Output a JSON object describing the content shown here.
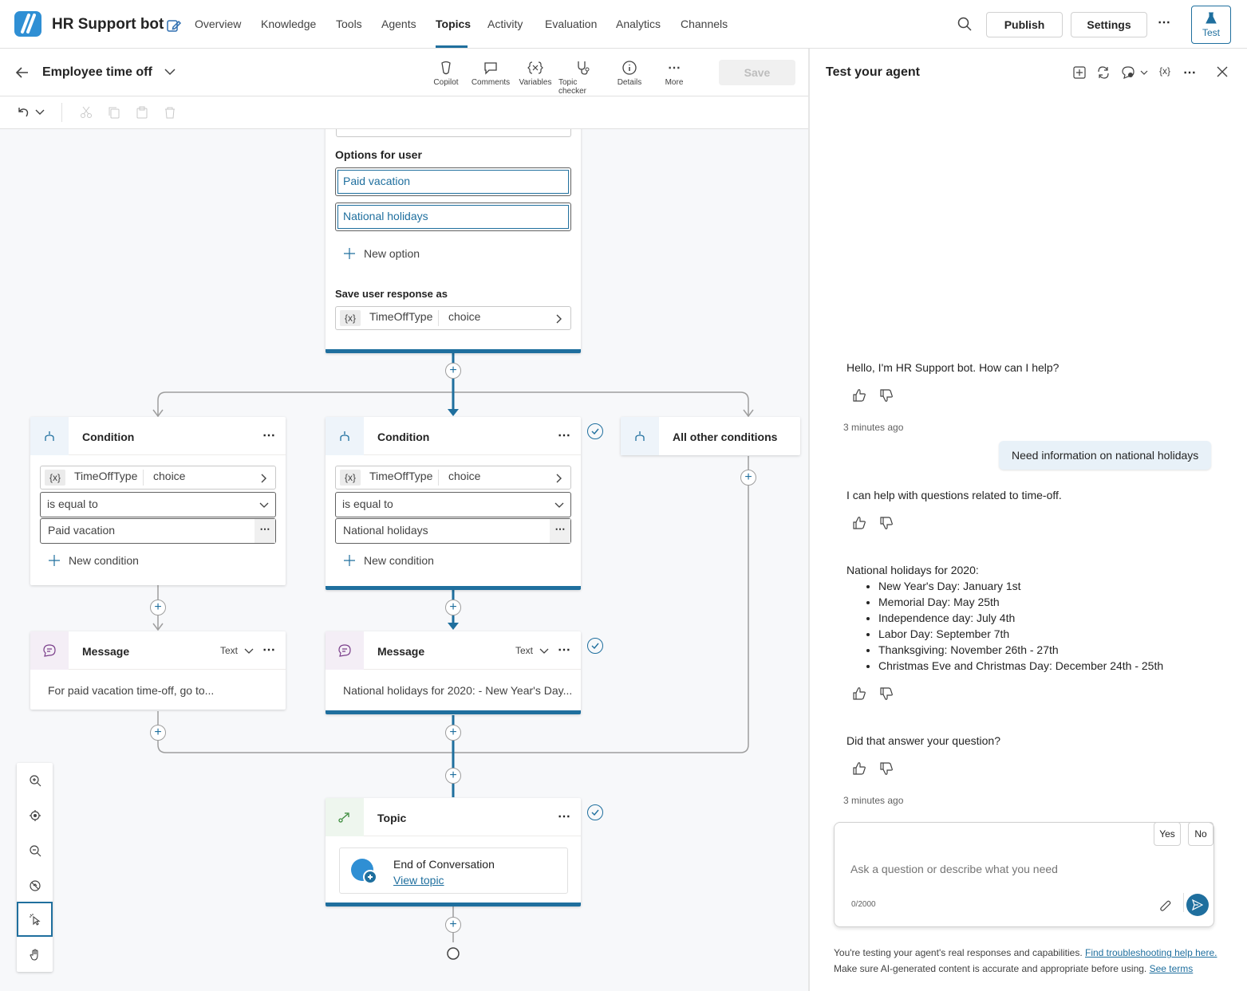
{
  "app": {
    "title": "HR Support bot"
  },
  "nav": [
    "Overview",
    "Knowledge",
    "Tools",
    "Agents",
    "Topics",
    "Activity",
    "Evaluation",
    "Analytics",
    "Channels"
  ],
  "nav_active": "Topics",
  "topbar": {
    "publish": "Publish",
    "settings": "Settings",
    "test": "Test",
    "more": "⋯"
  },
  "topic": {
    "name": "Employee time off"
  },
  "toolbar": {
    "copilot": "Copilot",
    "comments": "Comments",
    "variables": "Variables",
    "topic_checker": "Topic checker",
    "details": "Details",
    "more": "More",
    "save": "Save",
    "more_glyph": "⋯"
  },
  "question_node": {
    "options_label": "Options for user",
    "options": [
      "Paid vacation",
      "National holidays"
    ],
    "new_option": "New option",
    "save_label": "Save user response as",
    "var_name": "TimeOffType",
    "var_type": "choice",
    "var_icon": "{x}"
  },
  "conditions": [
    {
      "title": "Condition",
      "var": "TimeOffType",
      "type": "choice",
      "operator": "is equal to",
      "value": "Paid vacation",
      "new_condition": "New condition"
    },
    {
      "title": "Condition",
      "var": "TimeOffType",
      "type": "choice",
      "operator": "is equal to",
      "value": "National holidays",
      "new_condition": "New condition"
    },
    {
      "title": "All other conditions"
    }
  ],
  "messages": [
    {
      "title": "Message",
      "mode": "Text",
      "text": "For paid vacation time-off, go to..."
    },
    {
      "title": "Message",
      "mode": "Text",
      "text": "National holidays for 2020: - New Year's Day..."
    }
  ],
  "topic_node": {
    "title": "Topic",
    "target": "End of Conversation",
    "link": "View topic"
  },
  "dots": "⋯",
  "test_panel": {
    "title": "Test your agent",
    "greeting": "Hello, I'm HR Support bot. How can I help?",
    "timestamp1": "3 minutes ago",
    "user_msg": "Need information on national holidays",
    "reply1": "I can help with questions related to time-off.",
    "holidays_title": "National holidays for 2020:",
    "holidays": [
      "New Year's Day: January 1st",
      "Memorial Day: May 25th",
      "Independence day: July 4th",
      "Labor Day: September 7th",
      "Thanksgiving: November 26th - 27th",
      "Christmas Eve and Christmas Day: December 24th - 25th"
    ],
    "question": "Did that answer your question?",
    "timestamp2": "3 minutes ago",
    "yes": "Yes",
    "no": "No",
    "input_placeholder": "Ask a question or describe what you need",
    "char_count": "0/2000",
    "footer_text1": "You're testing your agent's real responses and capabilities. ",
    "footer_link1": "Find troubleshooting help here.",
    "footer_text2": " Make sure AI-generated content is accurate and appropriate before using. ",
    "footer_link2": "See terms",
    "var_icon": "{x}",
    "more": "⋯"
  },
  "colors": {
    "accent": "#1f6f9e",
    "bubble": "#e8f1f8"
  }
}
